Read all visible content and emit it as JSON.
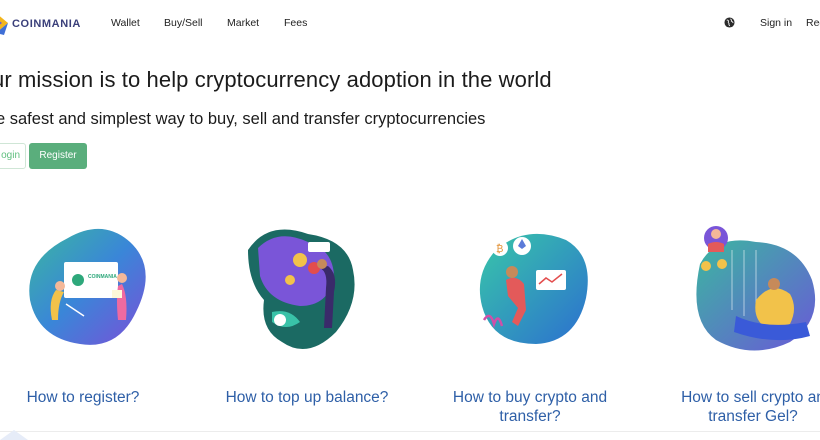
{
  "nav": {
    "logo_text": "COINMANIA",
    "links": [
      "Wallet",
      "Buy/Sell",
      "Market",
      "Fees"
    ],
    "globe_icon": "globe-icon",
    "sign_in": "Sign in",
    "register": "Register"
  },
  "hero": {
    "title": "ur mission is to help cryptocurrency adoption in the world",
    "subtitle": "e safest and simplest way to buy, sell and transfer cryptocurrencies",
    "login_button": "ogin",
    "register_button": "Register"
  },
  "cards": [
    {
      "title_line1": "How to register?",
      "title_line2": "",
      "illustration_badge": "COINMANIA"
    },
    {
      "title_line1": "How to top up balance?",
      "title_line2": ""
    },
    {
      "title_line1": "How to buy crypto and",
      "title_line2": "transfer?"
    },
    {
      "title_line1": "How to sell crypto an",
      "title_line2": "transfer Gel?"
    }
  ],
  "colors": {
    "accent_green": "#5aae7c",
    "link_blue": "#2e5fa7",
    "logo_blue": "#3a3f7a",
    "logo_yellow": "#f2b51c"
  }
}
